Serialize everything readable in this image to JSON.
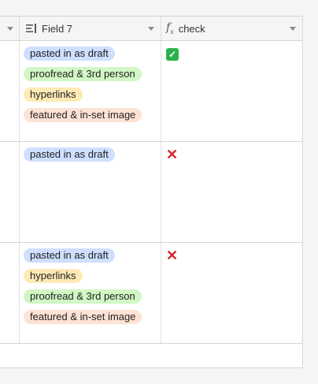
{
  "columns": [
    {
      "name": "",
      "icon": "chevron-down-icon"
    },
    {
      "name": "Field 7",
      "icon": "multiple-select-icon"
    },
    {
      "name": "check",
      "icon": "formula-icon"
    }
  ],
  "rows": [
    {
      "tags": [
        {
          "label": "pasted in as draft",
          "color": "#cfdfff"
        },
        {
          "label": "proofread & 3rd person",
          "color": "#d1f7c4"
        },
        {
          "label": "hyperlinks",
          "color": "#ffeab6"
        },
        {
          "label": "featured & in-set image",
          "color": "#fee2d5"
        }
      ],
      "check": "✅"
    },
    {
      "tags": [
        {
          "label": "pasted in as draft",
          "color": "#cfdfff"
        }
      ],
      "check": "❌"
    },
    {
      "tags": [
        {
          "label": "pasted in as draft",
          "color": "#cfdfff"
        },
        {
          "label": "hyperlinks",
          "color": "#ffeab6"
        },
        {
          "label": "proofread & 3rd person",
          "color": "#d1f7c4"
        },
        {
          "label": "featured & in-set image",
          "color": "#fee2d5"
        }
      ],
      "check": "❌"
    }
  ]
}
